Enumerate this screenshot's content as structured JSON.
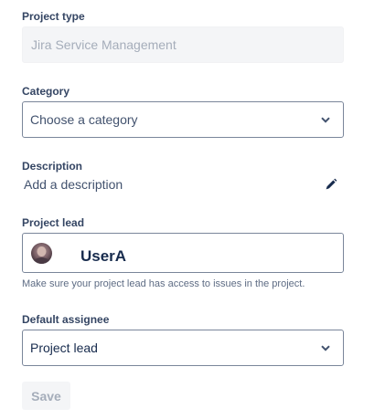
{
  "project_type": {
    "label": "Project type",
    "value": "Jira Service Management"
  },
  "category": {
    "label": "Category",
    "placeholder": "Choose a category",
    "icon": "chevron-down-icon"
  },
  "description": {
    "label": "Description",
    "text": "Add a description",
    "edit_icon": "pencil-icon"
  },
  "project_lead": {
    "label": "Project lead",
    "name": "UserA",
    "helper": "Make sure your project lead has access to issues in the project."
  },
  "default_assignee": {
    "label": "Default assignee",
    "value": "Project lead",
    "icon": "chevron-down-icon"
  },
  "actions": {
    "save_label": "Save"
  },
  "colors": {
    "label": "#344563",
    "border": "#7a869a",
    "disabled_bg": "#f4f5f7",
    "disabled_text": "#a5adba"
  }
}
